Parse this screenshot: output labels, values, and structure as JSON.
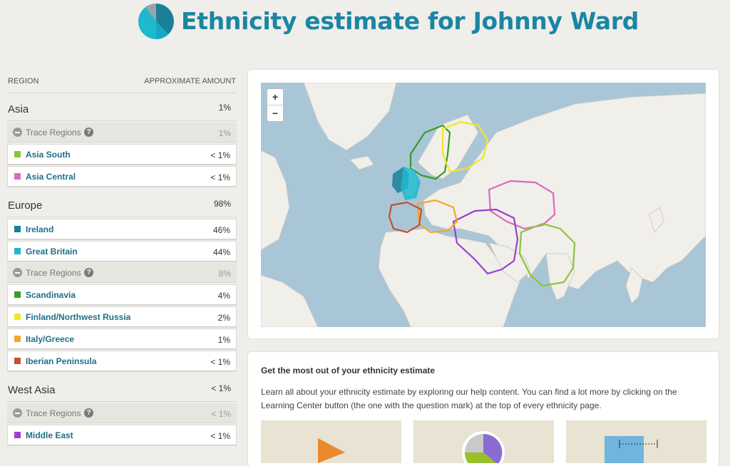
{
  "header": {
    "title": "Ethnicity estimate for Johnny Ward"
  },
  "table": {
    "col_region": "REGION",
    "col_amount": "APPROXIMATE AMOUNT",
    "groups": [
      {
        "name": "Asia",
        "amount": "1%",
        "trace_label": "Trace Regions",
        "trace_amount": "1%",
        "regions": [
          {
            "name": "Asia South",
            "amount": "< 1%",
            "color": "#8ac43f"
          },
          {
            "name": "Asia Central",
            "amount": "< 1%",
            "color": "#d96bbd"
          }
        ]
      },
      {
        "name": "Europe",
        "amount": "98%",
        "regions": [
          {
            "name": "Ireland",
            "amount": "46%",
            "color": "#1a7f99"
          },
          {
            "name": "Great Britain",
            "amount": "44%",
            "color": "#1cb9cf"
          }
        ],
        "trace_label": "Trace Regions",
        "trace_amount": "8%",
        "trace_regions": [
          {
            "name": "Scandinavia",
            "amount": "4%",
            "color": "#3a9a2a"
          },
          {
            "name": "Finland/Northwest Russia",
            "amount": "2%",
            "color": "#f2e42a"
          },
          {
            "name": "Italy/Greece",
            "amount": "1%",
            "color": "#f4a52a"
          },
          {
            "name": "Iberian Peninsula",
            "amount": "< 1%",
            "color": "#c4502c"
          }
        ]
      },
      {
        "name": "West Asia",
        "amount": "< 1%",
        "trace_label": "Trace Regions",
        "trace_amount": "< 1%",
        "regions": [
          {
            "name": "Middle East",
            "amount": "< 1%",
            "color": "#9b3fd1"
          }
        ]
      }
    ]
  },
  "map": {
    "zoom_in": "+",
    "zoom_out": "−"
  },
  "help": {
    "heading": "Get the most out of your ethnicity estimate",
    "body": "Learn all about your ethnicity estimate by exploring our help content. You can find a lot more by clicking on the Learning Center button (the one with the question mark) at the top of every ethnicity page."
  }
}
